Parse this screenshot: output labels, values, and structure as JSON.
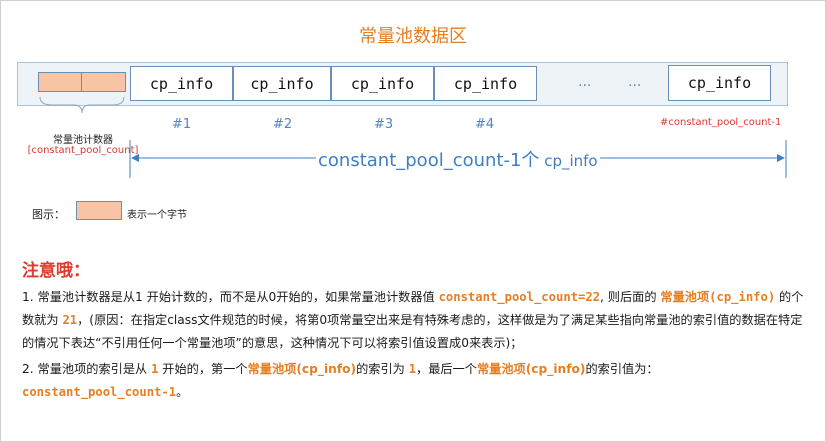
{
  "title": "常量池数据区",
  "cells": [
    "cp_info",
    "cp_info",
    "cp_info",
    "cp_info",
    "cp_info"
  ],
  "ellipsis": [
    "...",
    "..."
  ],
  "indices": [
    "#1",
    "#2",
    "#3",
    "#4"
  ],
  "last_index": "#constant_pool_count-1",
  "counter": {
    "label": "常量池计数器",
    "sublabel": "[constant_pool_count]"
  },
  "count": {
    "main": "constant_pool_count-1个",
    "tail": " cp_info"
  },
  "legend": {
    "label": "图示：",
    "desc": "表示一个字节"
  },
  "note_title": "注意哦：",
  "notes": {
    "p1_a": "1.   常量池计数器是从1 开始计数的，而不是从0开始的，如果常量池计数器值 ",
    "p1_code1": "constant_pool_count=22",
    "p1_b": ", 则后面的 ",
    "p1_term": "常量池项",
    "p1_code2": "(cp_info)",
    "p1_c": " 的个数就为 ",
    "p1_num": "21",
    "p1_d": "，(原因：在指定class文件规范的时候，将第0项常量空出来是有特殊考虑的，这样做是为了满足某些指向常量池的索引值的数据在特定的情况下表达“不引用任何一个常量池项”的意思，这种情况下可以将索引值设置成0来表示)；",
    "p2_a": "2.    常量池项的索引是从 ",
    "p2_one": "1",
    "p2_b": " 开始的，第一个",
    "p2_term1": "常量池项(cp_info)",
    "p2_c": "的索引为 ",
    "p2_one2": "1",
    "p2_d": "，最后一个",
    "p2_term2": "常量池项(cp_info)",
    "p2_e": "的索引值为：",
    "p2_code": "constant_pool_count-1",
    "p2_end": "。"
  },
  "colors": {
    "accent": "#e67e22",
    "blue": "#3f7fc0",
    "red": "#e03a2b",
    "counter_fill": "#f8c4a6",
    "strip": "#eef3f8"
  }
}
